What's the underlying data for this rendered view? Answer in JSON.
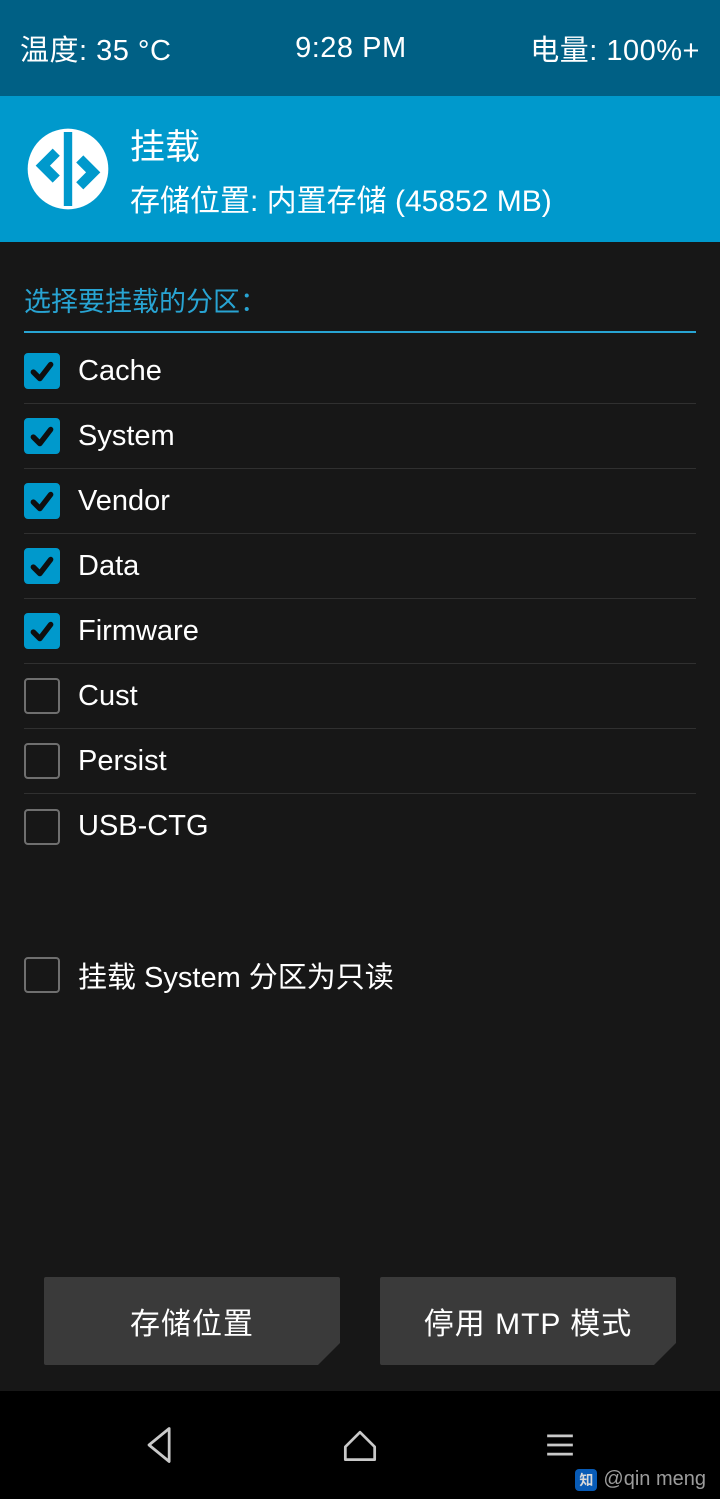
{
  "statusbar": {
    "temperature": "温度: 35 °C",
    "time": "9:28 PM",
    "battery": "电量: 100%+"
  },
  "header": {
    "title": "挂载",
    "subtitle": "存储位置: 内置存储 (45852 MB)"
  },
  "section_title": "选择要挂载的分区：",
  "partitions": [
    {
      "label": "Cache",
      "checked": true
    },
    {
      "label": "System",
      "checked": true
    },
    {
      "label": "Vendor",
      "checked": true
    },
    {
      "label": "Data",
      "checked": true
    },
    {
      "label": "Firmware",
      "checked": true
    },
    {
      "label": "Cust",
      "checked": false
    },
    {
      "label": "Persist",
      "checked": false
    },
    {
      "label": "USB-CTG",
      "checked": false
    }
  ],
  "readonly_option": {
    "label": "挂载 System 分区为只读",
    "checked": false
  },
  "buttons": {
    "storage": "存储位置",
    "mtp": "停用 MTP 模式"
  },
  "watermark": {
    "text": "@qin meng",
    "glyph": "知"
  }
}
